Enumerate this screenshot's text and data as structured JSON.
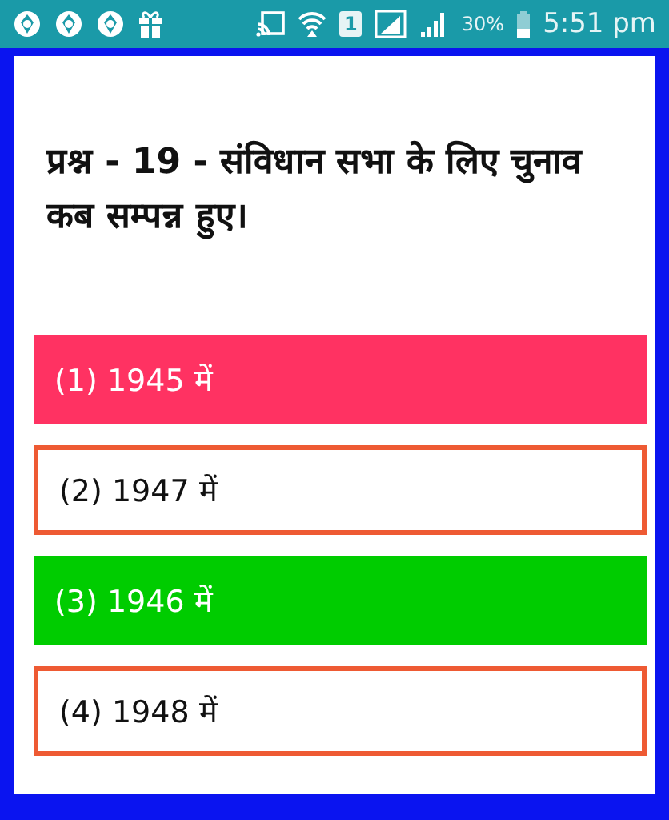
{
  "status_bar": {
    "sim_label": "1",
    "battery": "30%",
    "time": "5:51 pm"
  },
  "question": "प्रश्न - 19 - संविधान सभा के लिए चुनाव कब सम्पन्न हुए।",
  "options": [
    {
      "label": "(1) 1945 में",
      "kind": "wrong"
    },
    {
      "label": "(2) 1947 में",
      "kind": "plain"
    },
    {
      "label": "(3) 1946 में",
      "kind": "correct"
    },
    {
      "label": "(4) 1948 में",
      "kind": "plain"
    }
  ]
}
